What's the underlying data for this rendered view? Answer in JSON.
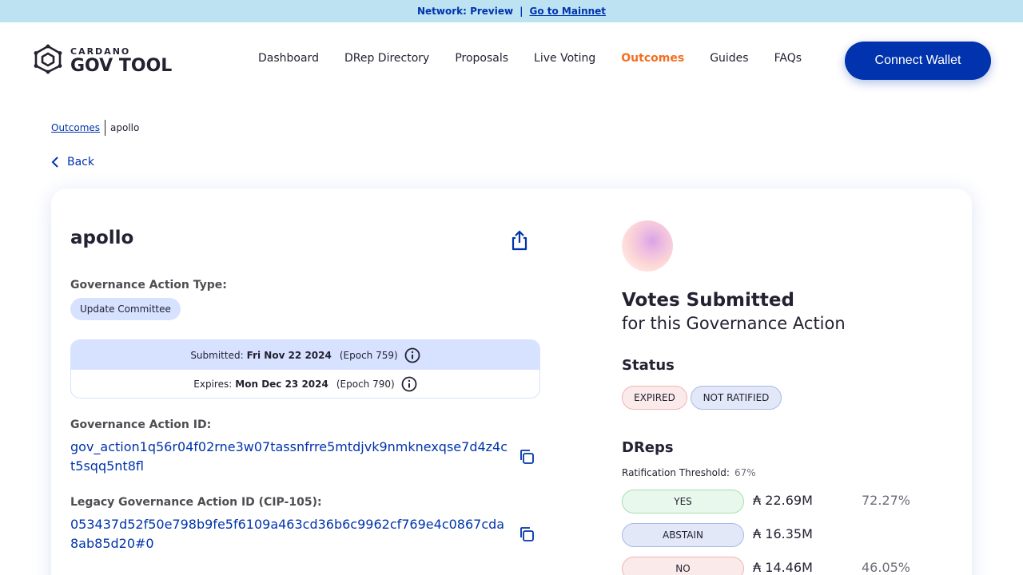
{
  "banner": {
    "network_label": "Network: Preview",
    "separator": "|",
    "mainnet_link": "Go to Mainnet"
  },
  "header": {
    "logo_small": "CARDANO",
    "logo_big": "GOV TOOL",
    "nav": [
      {
        "label": "Dashboard",
        "active": false
      },
      {
        "label": "DRep Directory",
        "active": false
      },
      {
        "label": "Proposals",
        "active": false
      },
      {
        "label": "Live Voting",
        "active": false
      },
      {
        "label": "Outcomes",
        "active": true
      },
      {
        "label": "Guides",
        "active": false
      },
      {
        "label": "FAQs",
        "active": false
      }
    ],
    "connect_wallet": "Connect Wallet"
  },
  "breadcrumb": {
    "parent": "Outcomes",
    "current": "apollo"
  },
  "back_label": "Back",
  "proposal": {
    "title": "apollo",
    "type_label": "Governance Action Type:",
    "type_value": "Update Committee",
    "submitted_label": "Submitted:",
    "submitted_date": "Fri Nov 22 2024",
    "submitted_epoch": "(Epoch 759)",
    "expires_label": "Expires:",
    "expires_date": "Mon Dec 23 2024",
    "expires_epoch": "(Epoch 790)",
    "id_label": "Governance Action ID:",
    "id_value": "gov_action1q56r04f02rne3w07tassnfrre5mtdjvk9nmknexqse7d4z4ct5sqq5nt8fl",
    "legacy_id_label": "Legacy Governance Action ID (CIP-105):",
    "legacy_id_value": "053437d52f50e798b9fe5f6109a463cd36b6c9962cf769e4c0867cda8ab85d20#0"
  },
  "votes": {
    "title": "Votes Submitted",
    "subtitle": "for this Governance Action",
    "status_heading": "Status",
    "status_badges": [
      "EXPIRED",
      "NOT RATIFIED"
    ],
    "dreps_heading": "DReps",
    "threshold_label": "Ratification Threshold:",
    "threshold_value": "67%",
    "rows": [
      {
        "label": "YES",
        "amount": "₳ 22.69M",
        "percent": "72.27%"
      },
      {
        "label": "ABSTAIN",
        "amount": "₳ 16.35M",
        "percent": ""
      },
      {
        "label": "NO",
        "amount": "₳ 14.46M",
        "percent": "46.05%"
      }
    ]
  },
  "colors": {
    "brand": "#0033ad",
    "active_nav": "#f26f21",
    "banner_bg": "#bde3f2"
  },
  "icons": [
    "cardano-hex-logo-icon",
    "chevron-left-icon",
    "share-icon",
    "info-icon",
    "copy-icon"
  ]
}
